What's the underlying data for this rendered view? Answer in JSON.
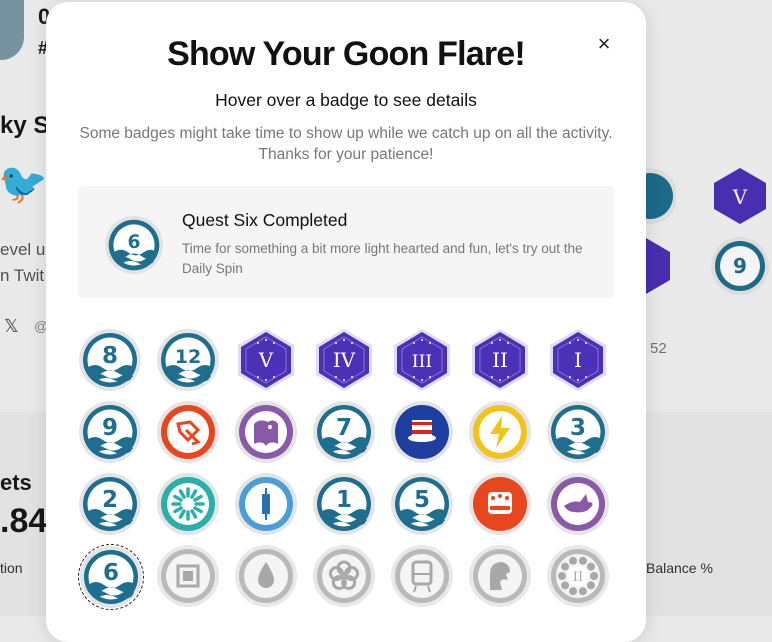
{
  "background": {
    "fragments": [
      "0",
      "#",
      "ky S",
      "evel u",
      "n Twit",
      "@",
      "52",
      "ets",
      ".84",
      "tion",
      "Balance %"
    ]
  },
  "modal": {
    "title": "Show Your Goon Flare!",
    "subtitle": "Hover over a badge to see details",
    "notice": "Some badges might take time to show up while we catch up on all the activity. Thanks for your patience!",
    "close_label": "×",
    "detail": {
      "title": "Quest Six Completed",
      "description": "Time for something a bit more light hearted and fun, let's try out the Daily Spin"
    }
  },
  "badges": [
    {
      "name": "quest-8",
      "kind": "quest",
      "label": "8"
    },
    {
      "name": "quest-12",
      "kind": "quest",
      "label": "12"
    },
    {
      "name": "rank-v",
      "kind": "hex",
      "label": "V"
    },
    {
      "name": "rank-iv",
      "kind": "hex",
      "label": "IV"
    },
    {
      "name": "rank-iii",
      "kind": "hex",
      "label": "III"
    },
    {
      "name": "rank-ii",
      "kind": "hex",
      "label": "II"
    },
    {
      "name": "rank-i",
      "kind": "hex",
      "label": "I"
    },
    {
      "name": "quest-9",
      "kind": "quest",
      "label": "9"
    },
    {
      "name": "orange-tag",
      "kind": "icon",
      "icon": "tag-icon",
      "color": "#e8461c"
    },
    {
      "name": "purple-eagle",
      "kind": "icon",
      "icon": "eagle-icon",
      "color": "#8a5aa8"
    },
    {
      "name": "quest-7",
      "kind": "quest",
      "label": "7"
    },
    {
      "name": "uncle-sam-hat",
      "kind": "icon",
      "icon": "hat-icon",
      "color": "#1e3fa0"
    },
    {
      "name": "lightning",
      "kind": "icon",
      "icon": "lightning-icon",
      "color": "#f2c418"
    },
    {
      "name": "quest-3",
      "kind": "quest",
      "label": "3"
    },
    {
      "name": "quest-2",
      "kind": "quest",
      "label": "2"
    },
    {
      "name": "teal-sunburst",
      "kind": "icon",
      "icon": "sunburst-icon",
      "color": "#2ab0a8"
    },
    {
      "name": "blue-candle",
      "kind": "icon",
      "icon": "candle-icon",
      "color": "#4a9ed8"
    },
    {
      "name": "quest-1",
      "kind": "quest",
      "label": "1"
    },
    {
      "name": "quest-5",
      "kind": "quest",
      "label": "5"
    },
    {
      "name": "chef-hat",
      "kind": "icon",
      "icon": "chef-hat-icon",
      "color": "#e8461c"
    },
    {
      "name": "purple-bird",
      "kind": "icon",
      "icon": "bird-icon",
      "color": "#8a5aa8"
    },
    {
      "name": "quest-6",
      "kind": "quest",
      "label": "6",
      "selected": true
    },
    {
      "name": "locked-square",
      "kind": "locked",
      "icon": "square-icon"
    },
    {
      "name": "locked-drop",
      "kind": "locked",
      "icon": "drop-icon"
    },
    {
      "name": "locked-flower",
      "kind": "locked",
      "icon": "flower-icon"
    },
    {
      "name": "locked-train",
      "kind": "locked",
      "icon": "train-icon"
    },
    {
      "name": "locked-horse",
      "kind": "locked",
      "icon": "horse-icon"
    },
    {
      "name": "locked-ii",
      "kind": "locked",
      "icon": "roman-ii-icon",
      "label": "II"
    }
  ],
  "colors": {
    "quest_teal": "#1e6f8f",
    "rank_purple": "#4b30b8",
    "locked_gray": "#a8a8a8"
  }
}
